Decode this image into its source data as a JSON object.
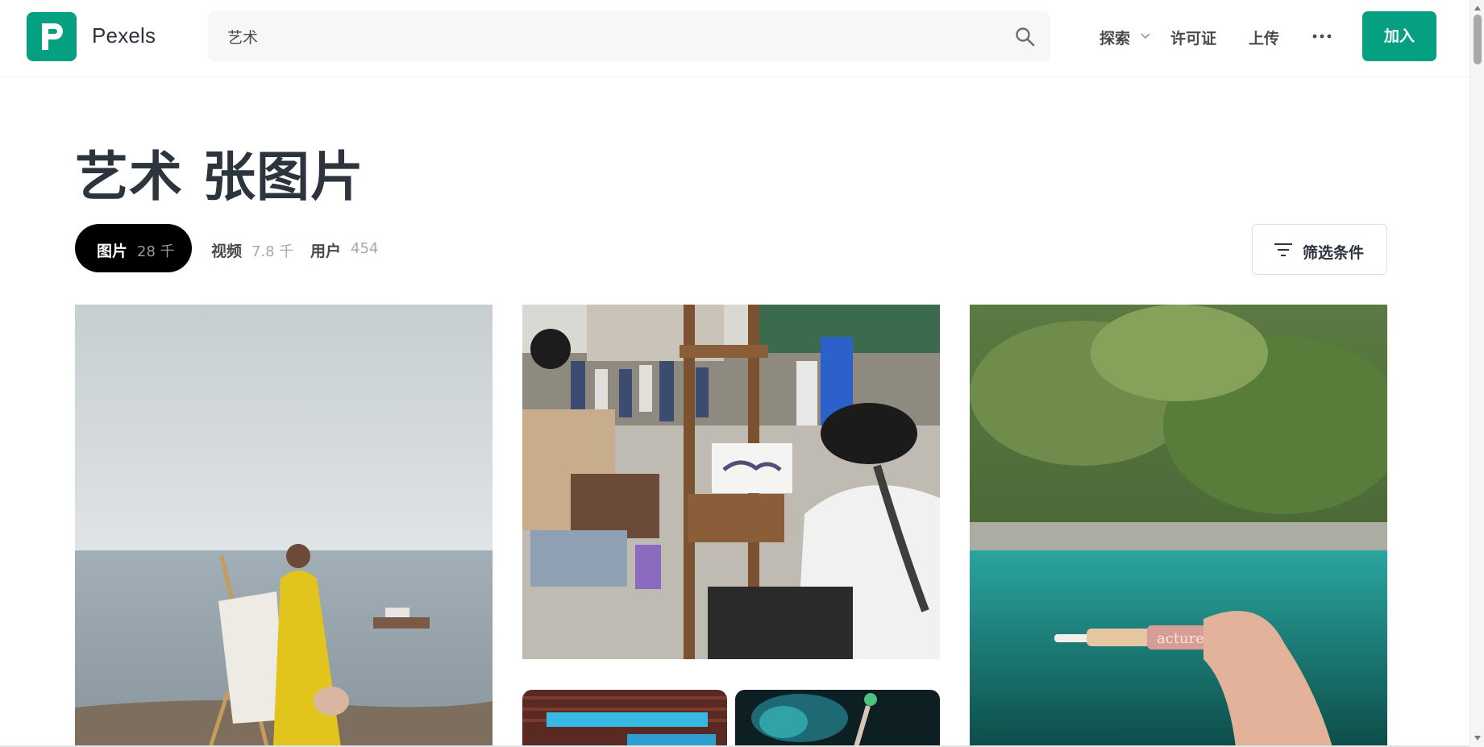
{
  "brand": {
    "name": "Pexels",
    "color": "#05a081"
  },
  "search": {
    "value": "艺术",
    "icon": "search-icon"
  },
  "nav": {
    "explore": "探索",
    "license": "许可证",
    "upload": "上传",
    "more_icon": "more-dots-icon",
    "join": "加入"
  },
  "page": {
    "title": "艺术 张图片"
  },
  "tabs": [
    {
      "label": "图片",
      "count": "28 千",
      "active": true
    },
    {
      "label": "视频",
      "count": "7.8 千",
      "active": false
    },
    {
      "label": "用户",
      "count": "454",
      "active": false
    }
  ],
  "filter": {
    "label": "筛选条件",
    "icon": "filter-icon"
  },
  "photos": [
    {
      "subject": "woman in yellow dress painting by the sea"
    },
    {
      "subject": "street artist sketching at an easel in a market"
    },
    {
      "subject": "hand holding lip gloss tube over green river"
    },
    {
      "subject": "blue neon light under a roof"
    },
    {
      "subject": "person with arm raised in blue smoke"
    }
  ],
  "photo_labels": {
    "tube": "acture"
  }
}
